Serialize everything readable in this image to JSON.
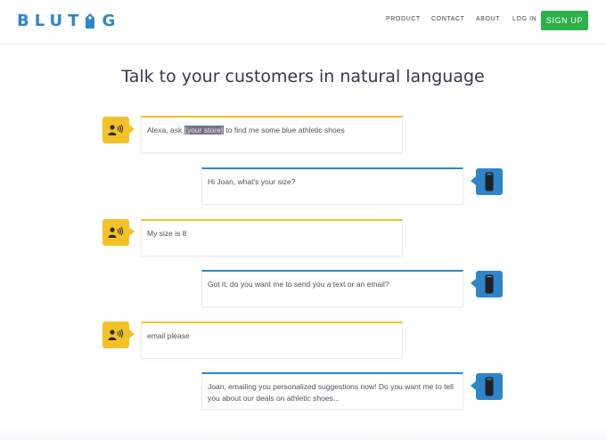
{
  "brand": {
    "logo_text_left": "BLUT",
    "logo_text_right": "G"
  },
  "nav": {
    "product": "PRODUCT",
    "contact": "CONTACT",
    "about": "ABOUT",
    "login": "LOG IN",
    "signup": "SIGN UP"
  },
  "title": "Talk to your customers in natural language",
  "colors": {
    "brand_blue": "#2e86c8",
    "user_yellow": "#f4c227",
    "signup_green": "#2db14a"
  },
  "icons": {
    "user": "person-speaking-icon",
    "bot": "echo-device-icon"
  },
  "conversation": [
    {
      "speaker": "user",
      "prefix": "Alexa, ask ",
      "highlight": "[your store]",
      "suffix": " to find me some blue athletic shoes"
    },
    {
      "speaker": "bot",
      "text": "Hi Joan, what's your size?"
    },
    {
      "speaker": "user",
      "text": "My size is 8"
    },
    {
      "speaker": "bot",
      "text": "Got it, do you want me to send you a text or an email?"
    },
    {
      "speaker": "user",
      "text": "email please"
    },
    {
      "speaker": "bot",
      "text": "Joan, emailing you personalized suggestions now! Do you want me to tell you about our deals on athletic shoes..."
    }
  ]
}
